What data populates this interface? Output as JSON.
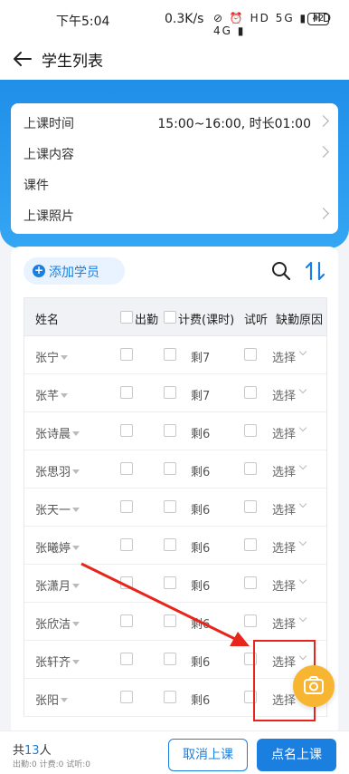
{
  "status_bar": {
    "time": "下午5:04",
    "net_speed": "0.3K/s",
    "icons": "⊘ ⏰ HD 5G ▮ HD 4G ▮",
    "battery": "42"
  },
  "header": {
    "title": "学生列表"
  },
  "info": {
    "rows": [
      {
        "label": "上课时间",
        "value": "15:00~16:00, 时长01:00"
      },
      {
        "label": "上课内容",
        "value": ""
      },
      {
        "label": "课件",
        "value": ""
      },
      {
        "label": "上课照片",
        "value": ""
      }
    ]
  },
  "toolbar": {
    "add_label": "添加学员"
  },
  "table": {
    "headers": {
      "name": "姓名",
      "attend": "出勤",
      "fee": "计费(课时)",
      "trial": "试听",
      "reason": "缺勤原因"
    },
    "rows": [
      {
        "name": "张宁",
        "fee": "剩7",
        "reason": "选择"
      },
      {
        "name": "张芊",
        "fee": "剩7",
        "reason": "选择"
      },
      {
        "name": "张诗晨",
        "fee": "剩6",
        "reason": "选择"
      },
      {
        "name": "张思羽",
        "fee": "剩6",
        "reason": "选择"
      },
      {
        "name": "张天一",
        "fee": "剩6",
        "reason": "选择"
      },
      {
        "name": "张曦婷",
        "fee": "剩6",
        "reason": "选择"
      },
      {
        "name": "张潇月",
        "fee": "剩6",
        "reason": "选择"
      },
      {
        "name": "张欣洁",
        "fee": "剩6",
        "reason": "选择"
      },
      {
        "name": "张轩齐",
        "fee": "剩6",
        "reason": "选择"
      },
      {
        "name": "张阳",
        "fee": "剩6",
        "reason": "选择"
      }
    ]
  },
  "bottom": {
    "total_prefix": "共",
    "total_count": "13",
    "total_suffix": "人",
    "stats": "出勤:0  计费:0  试听:0",
    "cancel_label": "取消上课",
    "call_label": "点名上课"
  },
  "colors": {
    "accent": "#1b7fe0",
    "camera": "#f7b531",
    "annotation": "#e8251b"
  }
}
